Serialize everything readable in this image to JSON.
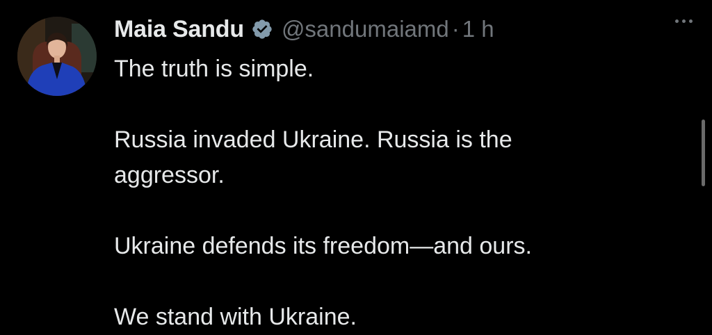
{
  "tweet": {
    "author": {
      "display_name": "Maia Sandu",
      "handle": "@sandumaiamd",
      "verified_icon": "verified-badge-icon",
      "avatar": "profile-photo"
    },
    "separator": "·",
    "time": "1 h",
    "more_icon": "more-horizontal-icon",
    "text_lines": [
      "The truth is simple.",
      "Russia invaded Ukraine. Russia is the",
      "aggressor.",
      "Ukraine defends its freedom—and ours.",
      "We stand with Ukraine."
    ]
  },
  "colors": {
    "background": "#000000",
    "primary_text": "#e7e9ea",
    "secondary_text": "#71767b",
    "verified_badge": "#829aab"
  }
}
